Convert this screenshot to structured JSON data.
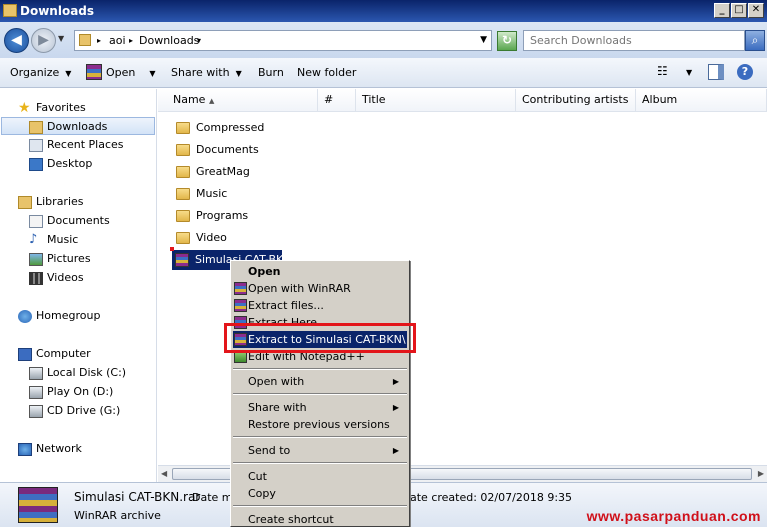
{
  "window": {
    "title": "Downloads"
  },
  "window_controls": {
    "minimize": "_",
    "maximize": "□",
    "close": "✕"
  },
  "address": {
    "crumbs": [
      "aoi",
      "Downloads"
    ],
    "search_placeholder": "Search Downloads"
  },
  "toolbar": {
    "organize": "Organize",
    "open": "Open",
    "share_with": "Share with",
    "burn": "Burn",
    "new_folder": "New folder"
  },
  "nav": {
    "favorites": "Favorites",
    "downloads": "Downloads",
    "recent": "Recent Places",
    "desktop": "Desktop",
    "libraries": "Libraries",
    "documents": "Documents",
    "music": "Music",
    "pictures": "Pictures",
    "videos": "Videos",
    "homegroup": "Homegroup",
    "computer": "Computer",
    "local_disk": "Local Disk (C:)",
    "play_on": "Play On (D:)",
    "cd_drive": "CD Drive (G:)",
    "network": "Network"
  },
  "columns": {
    "name": "Name",
    "num": "#",
    "title": "Title",
    "artists": "Contributing artists",
    "album": "Album"
  },
  "files": [
    {
      "name": "Compressed"
    },
    {
      "name": "Documents"
    },
    {
      "name": "GreatMag"
    },
    {
      "name": "Music"
    },
    {
      "name": "Programs"
    },
    {
      "name": "Video"
    },
    {
      "name": "Simulasi CAT-BKN"
    }
  ],
  "context_menu": {
    "open": "Open",
    "open_winrar": "Open with WinRAR",
    "extract_files": "Extract files...",
    "extract_here": "Extract Here",
    "extract_to": "Extract to Simulasi CAT-BKN\\",
    "edit_notepad": "Edit with Notepad++",
    "open_with": "Open with",
    "share_with": "Share with",
    "restore": "Restore previous versions",
    "send_to": "Send to",
    "cut": "Cut",
    "copy": "Copy",
    "create_shortcut": "Create shortcut"
  },
  "details": {
    "filename": "Simulasi CAT-BKN.rar",
    "date_modified_label": "Date mo",
    "date_created": "ate created: 02/07/2018 9:35",
    "type": "WinRAR archive"
  },
  "watermark": "www.pasarpanduan.com"
}
